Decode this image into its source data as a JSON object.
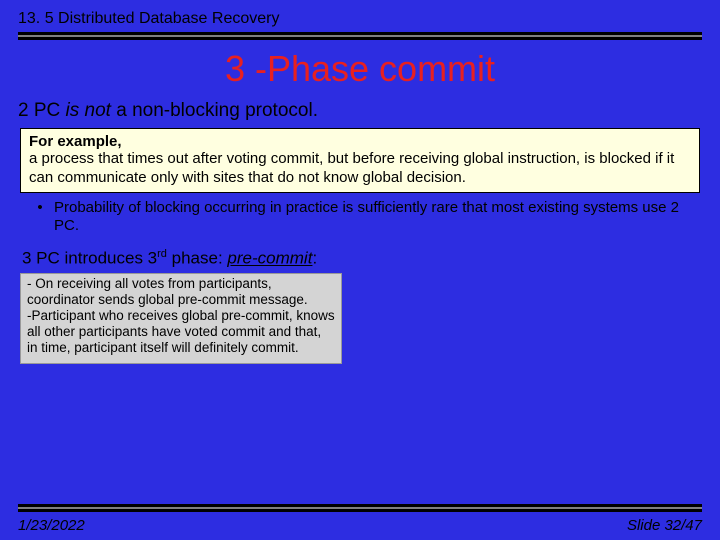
{
  "header": {
    "small_title": "13. 5 Distributed Database Recovery",
    "big_title": "3 -Phase commit"
  },
  "lead": {
    "prefix": "2 PC ",
    "emph": "is not",
    "suffix": " a non-blocking protocol."
  },
  "example_box": {
    "bold": "For example,",
    "text": "a process that times out after voting commit, but before receiving global instruction, is blocked if it can communicate only with sites that do not know global decision."
  },
  "bullet": {
    "text": "Probability of blocking occurring in practice is sufficiently rare that most existing systems use 2 PC."
  },
  "intro3pc": {
    "pre": "3 PC introduces 3",
    "sup": "rd",
    "mid": " phase: ",
    "emph": "pre-commit",
    "tail": ":"
  },
  "gray_box": {
    "p1": "- On receiving all votes from participants, coordinator sends global pre-commit message.",
    "p2": "-Participant who receives global pre-commit, knows all other participants have voted commit and that, in time, participant itself will definitely commit."
  },
  "footer": {
    "date": "1/23/2022",
    "slide": "Slide 32/47"
  }
}
